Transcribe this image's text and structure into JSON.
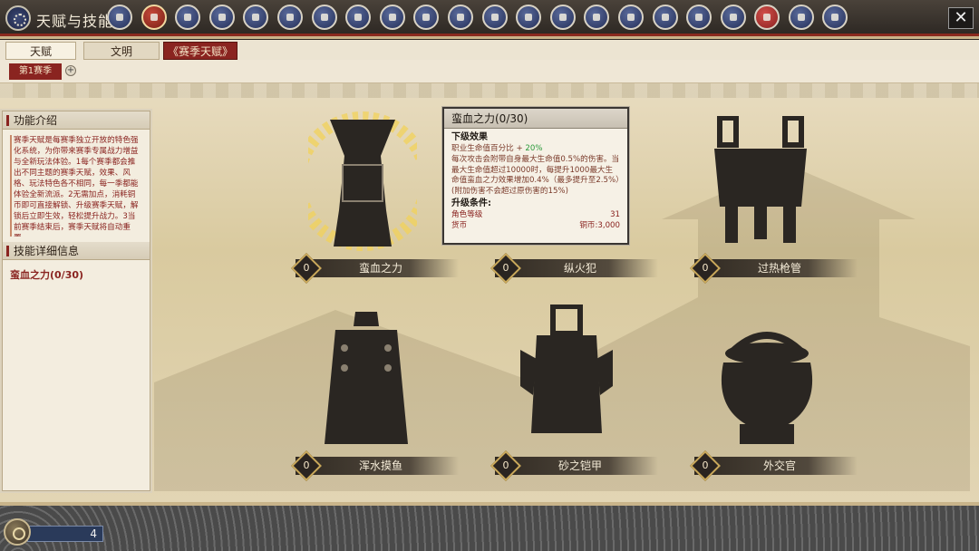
{
  "window": {
    "title": "天赋与技能",
    "close_label": "✕"
  },
  "nav": {
    "icon_count": 22,
    "active_index": 1,
    "red_index": 19
  },
  "tabs": {
    "talent": "天赋",
    "civilization": "文明",
    "season_talent": "赛季天赋"
  },
  "subtabs": {
    "season": "第1赛季",
    "add": "+"
  },
  "left_panel": {
    "intro_title": "功能介绍",
    "intro_text": "赛季天赋是每赛季独立开放的特色强化系统，为你带来赛季专属战力增益与全新玩法体验。1每个赛季都会推出不同主题的赛季天赋，效果、风格、玩法特色各不相同，每一季都能体验全新流派。2无需加点，消耗铜币即可直接解锁、升级赛季天赋，解锁后立即生效，轻松提升战力。3当前赛季结束后，赛季天赋将自动重置。",
    "detail_title": "技能详细信息",
    "selected_skill": "蛮血之力(0/30)"
  },
  "skills": [
    {
      "name": "蛮血之力",
      "level": "0"
    },
    {
      "name": "纵火犯",
      "level": "0"
    },
    {
      "name": "过热枪管",
      "level": "0"
    },
    {
      "name": "浑水摸鱼",
      "level": "0"
    },
    {
      "name": "砂之铠甲",
      "level": "0"
    },
    {
      "name": "外交官",
      "level": "0"
    }
  ],
  "tooltip": {
    "title": "蛮血之力(0/30)",
    "next_effect_label": "下级效果",
    "effect_prefix": "职业生命值百分比 + ",
    "effect_value": "20%",
    "effect_desc": "每次攻击会附带自身最大生命值0.5%的伤害。当最大生命值超过10000时，每提升1000最大生命值蛮血之力效果增加0.4%（最多提升至2.5%）(附加伤害不会超过原伤害的15%)",
    "upgrade_label": "升级条件:",
    "req_level_label": "角色等级",
    "req_level_value": "31",
    "req_currency_label": "货币",
    "req_currency_value": "铜币:3,000"
  },
  "currency": {
    "amount": "4"
  },
  "colors": {
    "accent_red": "#8a2420",
    "gold": "#c9a85a",
    "green": "#2a9a3a"
  }
}
